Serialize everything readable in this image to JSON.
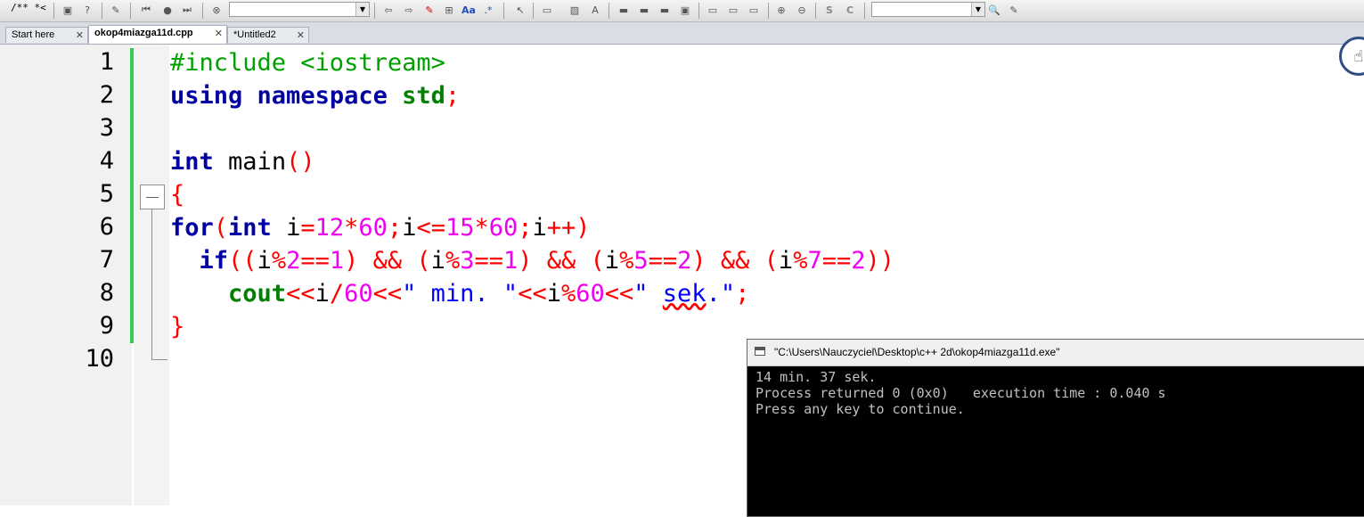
{
  "toolbar": {
    "comment_label": "/** *<",
    "zoom_in_icon": "zoom-in-icon",
    "zoom_out_icon": "zoom-out-icon"
  },
  "tabs": [
    {
      "label": "Start here"
    },
    {
      "label": "okop4miazga11d.cpp"
    },
    {
      "label": "*Untitled2"
    }
  ],
  "editor": {
    "line_numbers": [
      "1",
      "2",
      "3",
      "4",
      "5",
      "6",
      "7",
      "8",
      "9",
      "10"
    ]
  },
  "code_tokens": {
    "l1_include": "#include <iostream>",
    "l2_using": "using",
    "l2_namespace": "namespace",
    "l2_std": "std",
    "l2_semi": ";",
    "l4_int": "int",
    "l4_main": "main",
    "l4_parens": "()",
    "l5_brace": "{",
    "l6_for": "for",
    "l6_lparen": "(",
    "l6_int": "int",
    "l6_i1": "i",
    "l6_eq": "=",
    "l6_12": "12",
    "l6_mul1": "*",
    "l6_60a": "60",
    "l6_semi1": ";",
    "l6_i2": "i",
    "l6_le": "<=",
    "l6_15": "15",
    "l6_mul2": "*",
    "l6_60b": "60",
    "l6_semi2": ";",
    "l6_i3": "i",
    "l6_inc": "++)",
    "l7_if": "if",
    "l7_a": "((",
    "l7_i1": "i",
    "l7_mod1": "%",
    "l7_2a": "2",
    "l7_eqeq1": "==",
    "l7_1a": "1",
    "l7_b": ") && (",
    "l7_i2": "i",
    "l7_mod2": "%",
    "l7_3": "3",
    "l7_eqeq2": "==",
    "l7_1b": "1",
    "l7_c": ") && (",
    "l7_i3": "i",
    "l7_mod3": "%",
    "l7_5": "5",
    "l7_eqeq3": "==",
    "l7_2b": "2",
    "l7_d": ") && (",
    "l7_i4": "i",
    "l7_mod4": "%",
    "l7_7": "7",
    "l7_eqeq4": "==",
    "l7_2c": "2",
    "l7_e": "))",
    "l8_cout": "cout",
    "l8_shl1": "<<",
    "l8_i1": "i",
    "l8_div": "/",
    "l8_60a": "60",
    "l8_shl2": "<<",
    "l8_str1": "\" min. \"",
    "l8_shl3": "<<",
    "l8_i2": "i",
    "l8_mod": "%",
    "l8_60b": "60",
    "l8_shl4": "<<",
    "l8_str2a": "\" ",
    "l8_str2b": "sek",
    "l8_str2c": ".\"",
    "l8_semi": ";",
    "l9_brace": "}"
  },
  "console": {
    "title": "\"C:\\Users\\Nauczyciel\\Desktop\\c++ 2d\\okop4miazga11d.exe\"",
    "lines": [
      "14 min. 37 sek.",
      "Process returned 0 (0x0)   execution time : 0.040 s",
      "Press any key to continue."
    ]
  },
  "colors": {
    "keyword": "#0000a0",
    "preprocessor": "#00a000",
    "operator": "#ff0000",
    "number": "#f000f0",
    "string": "#0000ff",
    "changebar": "#33cc55"
  }
}
